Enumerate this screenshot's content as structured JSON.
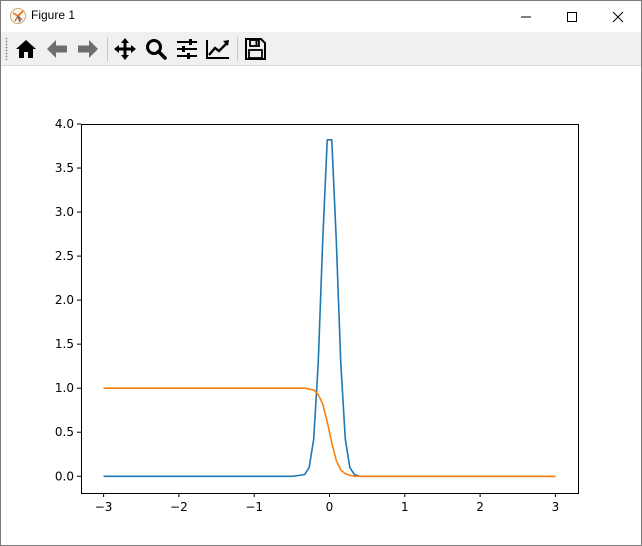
{
  "window": {
    "title": "Figure 1",
    "buttons": {
      "minimize": "minimize",
      "maximize": "maximize",
      "close": "close"
    }
  },
  "toolbar": {
    "items": [
      {
        "name": "home-icon",
        "label": "Home"
      },
      {
        "name": "back-icon",
        "label": "Back"
      },
      {
        "name": "forward-icon",
        "label": "Forward"
      },
      {
        "name": "pan-icon",
        "label": "Pan"
      },
      {
        "name": "zoom-icon",
        "label": "Zoom"
      },
      {
        "name": "subplots-icon",
        "label": "Subplots"
      },
      {
        "name": "customize-icon",
        "label": "Customize"
      },
      {
        "name": "save-icon",
        "label": "Save"
      }
    ]
  },
  "colors": {
    "series_blue": "#1f77b4",
    "series_orange": "#ff7f0e",
    "toolbar_bg": "#f0f0f0"
  },
  "chart_data": {
    "type": "line",
    "title": "",
    "xlabel": "",
    "ylabel": "",
    "xlim": [
      -3.3,
      3.3
    ],
    "ylim": [
      -0.19,
      4.0
    ],
    "xticks": [
      -3,
      -2,
      -1,
      0,
      1,
      2,
      3
    ],
    "xtick_labels": [
      "−3",
      "−2",
      "−1",
      "0",
      "1",
      "2",
      "3"
    ],
    "yticks": [
      0.0,
      0.5,
      1.0,
      1.5,
      2.0,
      2.5,
      3.0,
      3.5,
      4.0
    ],
    "ytick_labels": [
      "0.0",
      "0.5",
      "1.0",
      "1.5",
      "2.0",
      "2.5",
      "3.0",
      "3.5",
      "4.0"
    ],
    "grid": false,
    "series": [
      {
        "x": [
          -3.0,
          -2.0,
          -1.0,
          -0.5,
          -0.4,
          -0.33,
          -0.27,
          -0.21,
          -0.15,
          -0.09,
          -0.03,
          0.03,
          0.09,
          0.15,
          0.21,
          0.27,
          0.33,
          0.4,
          0.5,
          1.0,
          2.0,
          3.0
        ],
        "values": [
          0.0,
          0.0,
          0.0,
          0.0,
          0.01,
          0.02,
          0.1,
          0.42,
          1.28,
          2.68,
          3.82,
          3.82,
          2.68,
          1.28,
          0.42,
          0.1,
          0.02,
          0.0,
          0.0,
          0.0,
          0.0,
          0.0
        ]
      },
      {
        "x": [
          -3.0,
          -2.0,
          -1.0,
          -0.5,
          -0.33,
          -0.27,
          -0.21,
          -0.15,
          -0.09,
          -0.03,
          0.03,
          0.09,
          0.15,
          0.21,
          0.27,
          0.33,
          0.45,
          0.6,
          1.0,
          2.0,
          3.0
        ],
        "values": [
          1.0,
          1.0,
          1.0,
          1.0,
          1.0,
          0.99,
          0.98,
          0.93,
          0.82,
          0.62,
          0.38,
          0.18,
          0.07,
          0.03,
          0.01,
          0.0,
          0.0,
          0.0,
          0.0,
          0.0,
          0.0
        ]
      }
    ]
  }
}
